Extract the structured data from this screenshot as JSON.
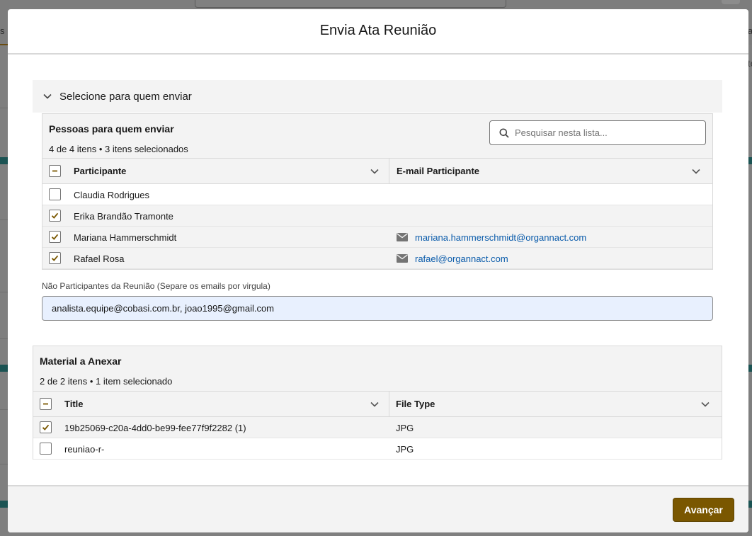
{
  "modal": {
    "title": "Envia Ata Reunião",
    "section_label": "Selecione para quem enviar",
    "next_button": "Avançar"
  },
  "people": {
    "title": "Pessoas para quem enviar",
    "summary": "4 de 4 itens • 3 itens selecionados",
    "search_placeholder": "Pesquisar nesta lista...",
    "columns": [
      "Participante",
      "E-mail Participante"
    ],
    "rows": [
      {
        "name": "Claudia Rodrigues",
        "email": "",
        "checked": false
      },
      {
        "name": "Erika Brandão Tramonte",
        "email": "",
        "checked": true
      },
      {
        "name": "Mariana Hammerschmidt",
        "email": "mariana.hammerschmidt@organnact.com",
        "checked": true
      },
      {
        "name": "Rafael Rosa",
        "email": "rafael@organnact.com",
        "checked": true
      }
    ]
  },
  "non_participants": {
    "label": "Não Participantes da Reunião (Separe os emails por virgula)",
    "value": "analista.equipe@cobasi.com.br, joao1995@gmail.com"
  },
  "material": {
    "title": "Material a Anexar",
    "summary": "2 de 2 itens • 1 item selecionado",
    "columns": [
      "Title",
      "File Type"
    ],
    "rows": [
      {
        "title": "19b25069-c20a-4dd0-be99-fee77f9f2282 (1)",
        "file_type": "JPG",
        "checked": true
      },
      {
        "title": "reuniao-r-",
        "file_type": "JPG",
        "checked": false
      }
    ]
  },
  "background": {
    "left_fragment": "s",
    "right_fragment_1": "a",
    "right_fragment_2": "te"
  },
  "colors": {
    "brand": "#7a5700",
    "link": "#0b5cab",
    "input_fill": "#e8f0fe"
  }
}
